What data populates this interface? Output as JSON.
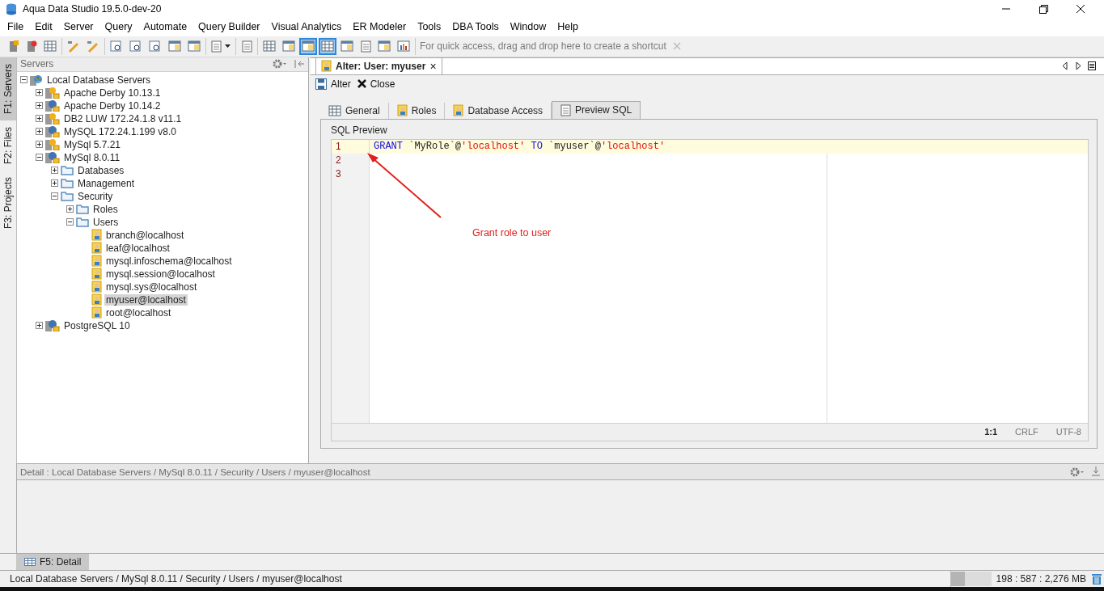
{
  "window": {
    "title": "Aqua Data Studio 19.5.0-dev-20"
  },
  "menu": [
    "File",
    "Edit",
    "Server",
    "Query",
    "Automate",
    "Query Builder",
    "Visual Analytics",
    "ER Modeler",
    "Tools",
    "DBA Tools",
    "Window",
    "Help"
  ],
  "toolbar": {
    "groups": [
      [
        {
          "kind": "add",
          "selected": false
        },
        {
          "kind": "remove",
          "selected": false
        },
        {
          "kind": "grid",
          "selected": false
        }
      ],
      [
        {
          "kind": "pen",
          "selected": false
        },
        {
          "kind": "pen",
          "selected": false
        }
      ],
      [
        {
          "kind": "find",
          "selected": false
        },
        {
          "kind": "find",
          "selected": false
        },
        {
          "kind": "find",
          "selected": false
        },
        {
          "kind": "window",
          "selected": false
        },
        {
          "kind": "window",
          "selected": false
        }
      ],
      [
        {
          "kind": "doc-dropdown",
          "selected": false
        }
      ],
      [
        {
          "kind": "doc",
          "selected": false
        }
      ],
      [
        {
          "kind": "grid",
          "selected": false
        },
        {
          "kind": "window",
          "selected": false
        },
        {
          "kind": "window",
          "selected": true
        },
        {
          "kind": "grid",
          "selected": true
        },
        {
          "kind": "window",
          "selected": false
        },
        {
          "kind": "doc",
          "selected": false
        },
        {
          "kind": "window",
          "selected": false
        },
        {
          "kind": "chart",
          "selected": false
        }
      ]
    ],
    "shortcut_hint": "For quick access, drag and drop here to create a shortcut"
  },
  "side_tabs": [
    {
      "label": "F1: Servers",
      "selected": true
    },
    {
      "label": "F2: Files",
      "selected": false
    },
    {
      "label": "F3: Projects",
      "selected": false
    }
  ],
  "servers_panel": {
    "title": "Servers",
    "tree": [
      {
        "label": "Local Database Servers",
        "kind": "root",
        "expanded": true,
        "selected": false,
        "children": [
          {
            "label": "Apache Derby 10.13.1",
            "kind": "server",
            "expanded": false,
            "selected": false
          },
          {
            "label": "Apache Derby 10.14.2",
            "kind": "plug",
            "expanded": false,
            "selected": false
          },
          {
            "label": "DB2 LUW 172.24.1.8 v11.1",
            "kind": "server",
            "expanded": false,
            "selected": false
          },
          {
            "label": "MySQL 172.24.1.199 v8.0",
            "kind": "plug",
            "expanded": false,
            "selected": false
          },
          {
            "label": "MySql 5.7.21",
            "kind": "server",
            "expanded": false,
            "selected": false
          },
          {
            "label": "MySql 8.0.11",
            "kind": "plug",
            "expanded": true,
            "selected": false,
            "children": [
              {
                "label": "Databases",
                "kind": "folder",
                "expanded": false,
                "selected": false
              },
              {
                "label": "Management",
                "kind": "folder",
                "expanded": false,
                "selected": false
              },
              {
                "label": "Security",
                "kind": "folder",
                "expanded": true,
                "selected": false,
                "children": [
                  {
                    "label": "Roles",
                    "kind": "folder",
                    "expanded": false,
                    "selected": false
                  },
                  {
                    "label": "Users",
                    "kind": "folder",
                    "expanded": true,
                    "selected": false,
                    "children": [
                      {
                        "label": "branch@localhost",
                        "kind": "user",
                        "selected": false
                      },
                      {
                        "label": "leaf@localhost",
                        "kind": "user",
                        "selected": false
                      },
                      {
                        "label": "mysql.infoschema@localhost",
                        "kind": "user",
                        "selected": false
                      },
                      {
                        "label": "mysql.session@localhost",
                        "kind": "user",
                        "selected": false
                      },
                      {
                        "label": "mysql.sys@localhost",
                        "kind": "user",
                        "selected": false
                      },
                      {
                        "label": "myuser@localhost",
                        "kind": "user",
                        "selected": true
                      },
                      {
                        "label": "root@localhost",
                        "kind": "user",
                        "selected": false
                      }
                    ]
                  }
                ]
              }
            ]
          },
          {
            "label": "PostgreSQL 10",
            "kind": "plug",
            "expanded": false,
            "selected": false
          }
        ]
      }
    ]
  },
  "editor": {
    "tab": {
      "title": "Alter: User: myuser",
      "close": "×"
    },
    "actions": [
      {
        "kind": "save",
        "label": "Alter"
      },
      {
        "kind": "close",
        "label": "Close"
      }
    ],
    "tabs": [
      {
        "label": "General",
        "selected": false
      },
      {
        "label": "Roles",
        "selected": false
      },
      {
        "label": "Database Access",
        "selected": false
      },
      {
        "label": "Preview SQL",
        "selected": true
      }
    ],
    "section": "SQL Preview",
    "lines": [
      {
        "number": "1",
        "current": true,
        "tokens": [
          {
            "kind": "keyword",
            "text": "GRANT"
          },
          {
            "kind": "plain",
            "text": " `MyRole`@"
          },
          {
            "kind": "string",
            "text": "'localhost'"
          },
          {
            "kind": "keyword",
            "text": " TO"
          },
          {
            "kind": "plain",
            "text": " `myuser`@"
          },
          {
            "kind": "string",
            "text": "'localhost'"
          }
        ]
      },
      {
        "number": "2",
        "current": false
      },
      {
        "number": "3",
        "current": false
      }
    ],
    "annotation": "Grant role to user",
    "status": {
      "position": "1:1",
      "line_ending": "CRLF",
      "encoding": "UTF-8"
    }
  },
  "detail": {
    "breadcrumb": "Detail : Local Database Servers / MySql 8.0.11 / Security / Users / myuser@localhost",
    "tab": "F5: Detail"
  },
  "status_bar": {
    "path": "Local Database Servers / MySql 8.0.11 / Security / Users / myuser@localhost",
    "memory": {
      "level": 0.35,
      "reading": "198 : 587 : 2,276 MB"
    }
  }
}
